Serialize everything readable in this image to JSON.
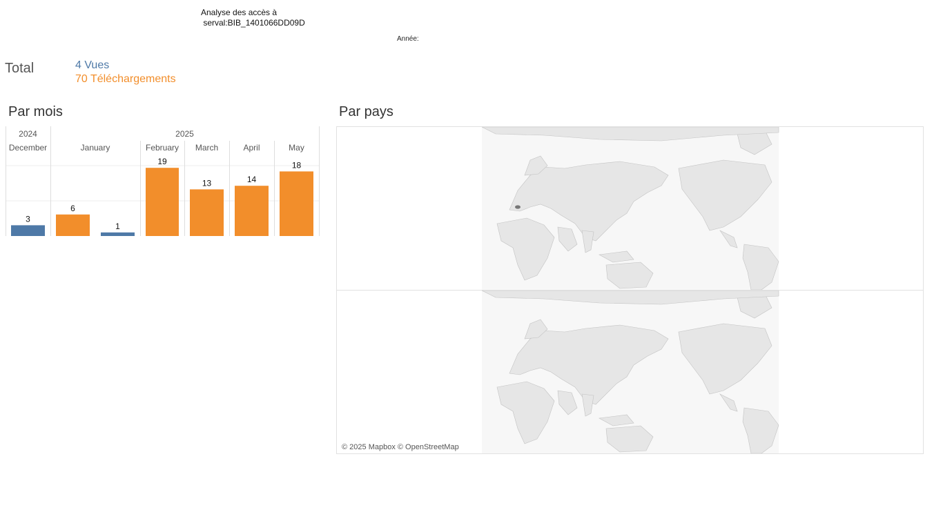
{
  "header": {
    "title": "Analyse des accès à\n serval:BIB_1401066DD09D",
    "year_filter_label": "Année:"
  },
  "totals": {
    "label": "Total",
    "views": "4 Vues",
    "downloads": "70 Téléchargements"
  },
  "colors": {
    "views": "#4e79a7",
    "downloads": "#f28e2b",
    "land": "#e6e6e6",
    "border": "#c2c2c2",
    "highlight": "#777777"
  },
  "sections": {
    "by_month": "Par mois",
    "by_country": "Par pays"
  },
  "chart_data": {
    "type": "bar",
    "title": "Par mois",
    "years": [
      {
        "label": "2024",
        "months": [
          "December"
        ]
      },
      {
        "label": "2025",
        "months": [
          "January",
          "February",
          "March",
          "April",
          "May"
        ]
      }
    ],
    "categories": [
      "December",
      "January",
      "February",
      "March",
      "April",
      "May"
    ],
    "series": [
      {
        "name": "Vues",
        "values": [
          3,
          0,
          1,
          0,
          0,
          0
        ]
      },
      {
        "name": "Téléchargements",
        "values": [
          0,
          6,
          19,
          13,
          14,
          18
        ]
      }
    ],
    "bars": [
      {
        "month": "December",
        "series": "Vues",
        "value": 3
      },
      {
        "month": "January",
        "series": "Téléchargements",
        "value": 6
      },
      {
        "month": "January",
        "series": "Vues",
        "value": 1
      },
      {
        "month": "February",
        "series": "Téléchargements",
        "value": 19
      },
      {
        "month": "March",
        "series": "Téléchargements",
        "value": 13
      },
      {
        "month": "April",
        "series": "Téléchargements",
        "value": 14
      },
      {
        "month": "May",
        "series": "Téléchargements",
        "value": 18
      }
    ],
    "ylim": [
      0,
      20
    ],
    "grid": true,
    "xlabel": "",
    "ylabel": ""
  },
  "map": {
    "type": "world-map",
    "panels": 2,
    "highlighted_country": "Switzerland",
    "attribution": "© 2025 Mapbox © OpenStreetMap"
  }
}
